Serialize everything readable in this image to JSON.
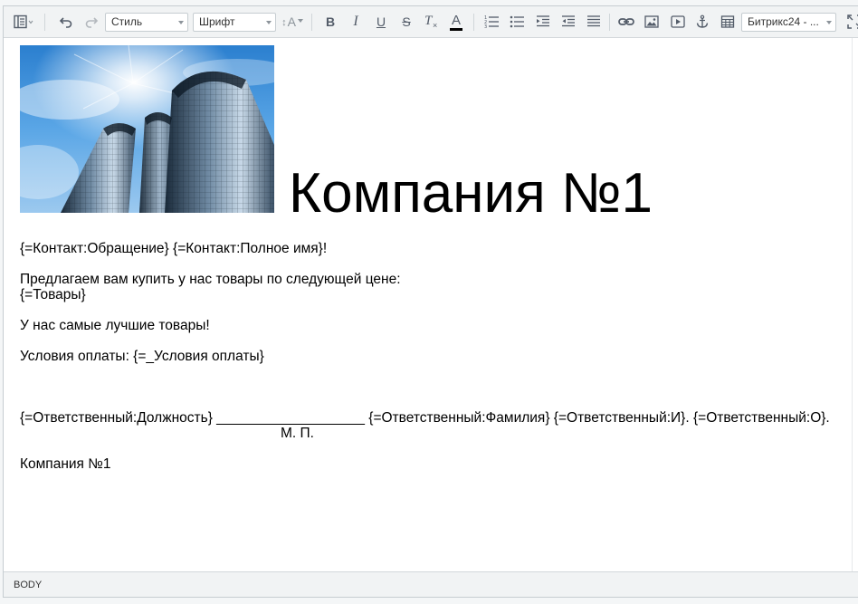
{
  "toolbar": {
    "style_select": "Стиль",
    "font_select": "Шрифт",
    "font_size_glyph": "A",
    "bold_glyph": "B",
    "italic_glyph": "I",
    "underline_glyph": "U",
    "strike_glyph": "S",
    "clear_glyph": "T",
    "color_glyph": "A",
    "template_select": "Битрикс24 - ...",
    "text_color": "#000000"
  },
  "document": {
    "heading": "Компания №1",
    "greeting": "{=Контакт:Обращение} {=Контакт:Полное имя}!",
    "offer": "Предлагаем вам купить у нас товары по следующей цене:",
    "products": "{=Товары}",
    "best": "У нас самые лучшие товары!",
    "payment": "Условия оплаты: {=_Условия оплаты}",
    "signature": "{=Ответственный:Должность} ___________________ {=Ответственный:Фамилия} {=Ответственный:И}. {=Ответственный:О}.",
    "stamp": "М. П.",
    "footer_company": "Компания №1"
  },
  "statusbar": {
    "path": "BODY"
  },
  "icons": [
    "view-mode-icon",
    "undo-icon",
    "redo-icon",
    "font-size-icon",
    "bold-icon",
    "italic-icon",
    "underline-icon",
    "strikethrough-icon",
    "remove-format-icon",
    "text-color-icon",
    "ordered-list-icon",
    "unordered-list-icon",
    "outdent-icon",
    "indent-icon",
    "align-justify-icon",
    "link-icon",
    "image-icon",
    "video-icon",
    "anchor-icon",
    "table-icon",
    "fullscreen-icon"
  ]
}
